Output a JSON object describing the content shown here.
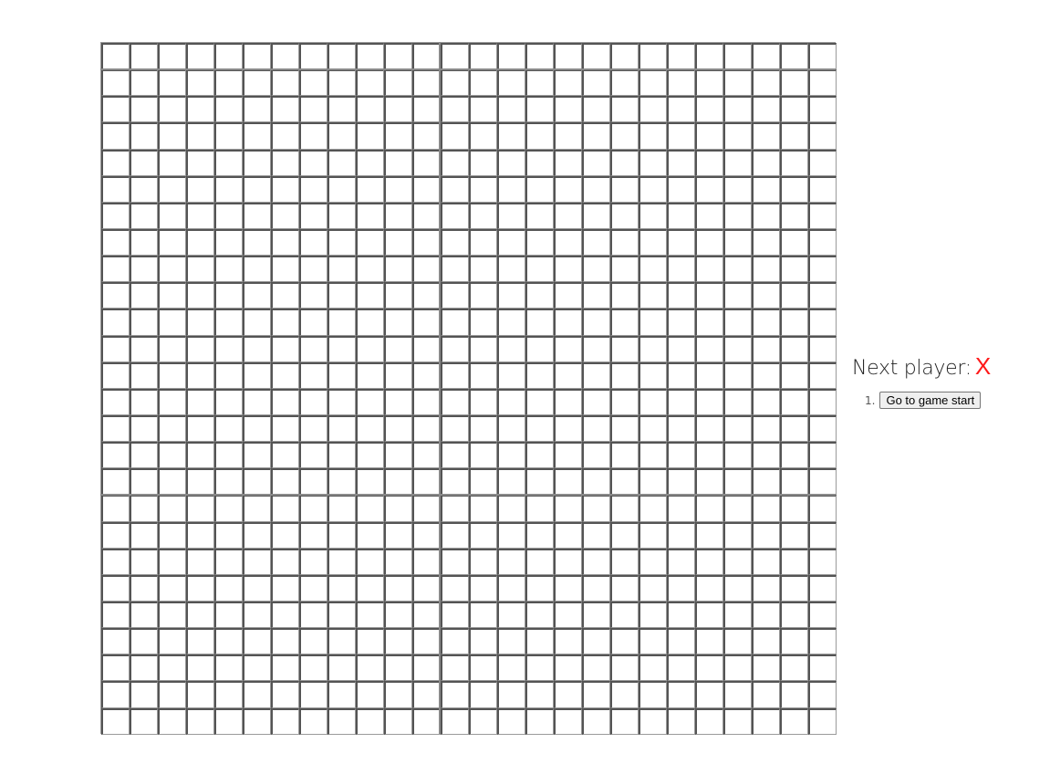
{
  "board": {
    "rows": 26,
    "cols": 26,
    "cells": []
  },
  "status": {
    "label": "Next player:",
    "player": "X",
    "player_color": "#ff1a1a"
  },
  "moves": [
    {
      "number": "1.",
      "label": "Go to game start"
    }
  ]
}
